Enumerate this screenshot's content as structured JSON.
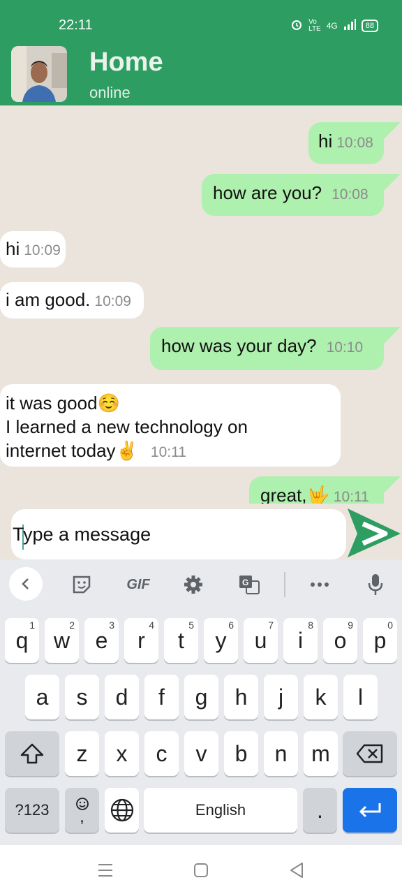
{
  "status_bar": {
    "time": "22:11",
    "network": "4G",
    "battery": "88"
  },
  "header": {
    "title": "Home",
    "status": "online"
  },
  "messages": [
    {
      "side": "sent",
      "text": "hi",
      "time": "10:08"
    },
    {
      "side": "sent",
      "text": "how are you?",
      "time": "10:08"
    },
    {
      "side": "received",
      "text": "hi",
      "time": "10:09"
    },
    {
      "side": "received",
      "text": "i am good.",
      "time": "10:09"
    },
    {
      "side": "sent",
      "text": "how was your day?",
      "time": "10:10"
    },
    {
      "side": "received",
      "lines": [
        "it was good☺️",
        "I learned a new technology on",
        "internet today✌️"
      ],
      "time": "10:11"
    },
    {
      "side": "sent",
      "text": "great,🤟",
      "time": "10:11"
    }
  ],
  "composer": {
    "placeholder": "Type a message"
  },
  "keyboard": {
    "toolbar": [
      "back",
      "sticker",
      "GIF",
      "settings",
      "translate",
      "more",
      "mic"
    ],
    "row1": [
      {
        "k": "q",
        "h": "1"
      },
      {
        "k": "w",
        "h": "2"
      },
      {
        "k": "e",
        "h": "3"
      },
      {
        "k": "r",
        "h": "4"
      },
      {
        "k": "t",
        "h": "5"
      },
      {
        "k": "y",
        "h": "6"
      },
      {
        "k": "u",
        "h": "7"
      },
      {
        "k": "i",
        "h": "8"
      },
      {
        "k": "o",
        "h": "9"
      },
      {
        "k": "p",
        "h": "0"
      }
    ],
    "row2": [
      "a",
      "s",
      "d",
      "f",
      "g",
      "h",
      "j",
      "k",
      "l"
    ],
    "row3": [
      "z",
      "x",
      "c",
      "v",
      "b",
      "n",
      "m"
    ],
    "symbols_label": "?123",
    "emoji_comma": ",",
    "space_label": "English",
    "period": "."
  }
}
